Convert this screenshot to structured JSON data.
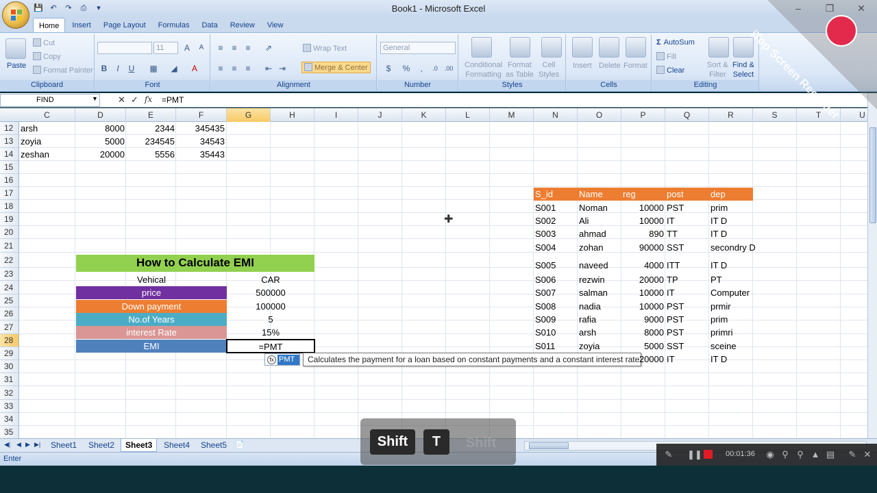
{
  "window": {
    "title": "Book1 - Microsoft Excel"
  },
  "ribbon": {
    "tabs": [
      "Home",
      "Insert",
      "Page Layout",
      "Formulas",
      "Data",
      "Review",
      "View"
    ],
    "clipboard": {
      "paste": "Paste",
      "cut": "Cut",
      "copy": "Copy",
      "format_painter": "Format Painter",
      "label": "Clipboard"
    },
    "font": {
      "size": "11",
      "label": "Font"
    },
    "alignment": {
      "wrap_text": "Wrap Text",
      "merge_center": "Merge & Center",
      "label": "Alignment"
    },
    "number": {
      "format": "General",
      "label": "Number"
    },
    "styles": {
      "conditional": "Conditional",
      "conditional2": "Formatting",
      "format_as": "Format",
      "format_as2": "as Table",
      "cell": "Cell",
      "cell2": "Styles",
      "label": "Styles"
    },
    "cells": {
      "insert": "Insert",
      "delete": "Delete",
      "format": "Format",
      "label": "Cells"
    },
    "editing": {
      "autosum": "AutoSum",
      "fill": "Fill",
      "clear": "Clear",
      "sort": "Sort &",
      "sort2": "Filter",
      "find": "Find &",
      "find2": "Select",
      "label": "Editing"
    }
  },
  "formula_bar": {
    "name_box": "FIND",
    "formula": "=PMT",
    "fx": "fx"
  },
  "columns": [
    "C",
    "D",
    "E",
    "F",
    "G",
    "H",
    "I",
    "J",
    "K",
    "L",
    "M",
    "N",
    "O",
    "P",
    "Q",
    "R",
    "S",
    "T",
    "U"
  ],
  "rows": [
    "12",
    "13",
    "14",
    "15",
    "16",
    "17",
    "18",
    "19",
    "20",
    "21",
    "22",
    "23",
    "24",
    "25",
    "26",
    "27",
    "28",
    "29",
    "30",
    "31",
    "32",
    "33",
    "34",
    "35"
  ],
  "left_table": [
    {
      "name": "arsh",
      "d": "8000",
      "e": "2344",
      "f": "345435"
    },
    {
      "name": "zoyia",
      "d": "5000",
      "e": "234545",
      "f": "34543"
    },
    {
      "name": "zeshan",
      "d": "20000",
      "e": "5556",
      "f": "35443"
    }
  ],
  "emi": {
    "title": "How to Calculate EMI",
    "vehical_label": "Vehical",
    "vehical_value": "CAR",
    "price_label": "price",
    "price_value": "500000",
    "down_label": "Down payment",
    "down_value": "100000",
    "years_label": "No.of Years",
    "years_value": "5",
    "rate_label": "interest Rate",
    "rate_value": "15%",
    "emi_label": "EMI",
    "emi_value": "=PMT",
    "colors": {
      "title": "#92d050",
      "price": "#7030a0",
      "down": "#ed7d31",
      "years": "#4bacc6",
      "rate": "#da9694",
      "emi": "#4f81bd"
    }
  },
  "autocomplete": {
    "item": "PMT",
    "tooltip": "Calculates the payment for a loan based on constant payments and a constant interest rate"
  },
  "staff_table": {
    "headers": [
      "S_id",
      "Name",
      "reg",
      "post",
      "dep"
    ],
    "rows": [
      [
        "S001",
        "Noman",
        "10000",
        "PST",
        "prim"
      ],
      [
        "S002",
        "Ali",
        "10000",
        "IT",
        "IT D"
      ],
      [
        "S003",
        "ahmad",
        "890",
        "TT",
        "IT D"
      ],
      [
        "S004",
        "zohan",
        "90000",
        "SST",
        "secondry D"
      ],
      [
        "S005",
        "naveed",
        "4000",
        "ITT",
        "IT D"
      ],
      [
        "S006",
        "rezwin",
        "20000",
        "TP",
        "PT"
      ],
      [
        "S007",
        "salman",
        "10000",
        "IT",
        "Computer"
      ],
      [
        "S008",
        "nadia",
        "10000",
        "PST",
        "prmir"
      ],
      [
        "S009",
        "rafia",
        "9000",
        "PST",
        "prim"
      ],
      [
        "S010",
        "arsh",
        "8000",
        "PST",
        "primri"
      ],
      [
        "S011",
        "zoyia",
        "5000",
        "SST",
        "sceine"
      ],
      [
        "",
        "",
        "20000",
        "IT",
        "IT D"
      ]
    ]
  },
  "sheets": [
    "Sheet1",
    "Sheet2",
    "Sheet3",
    "Sheet4",
    "Sheet5"
  ],
  "active_sheet": "Sheet3",
  "status": "Enter",
  "keystrokes": [
    "Shift",
    "T"
  ],
  "ghost_key": "Shift",
  "recorder": {
    "time": "00:01:36",
    "watermark": "iTop Screen Recorder"
  }
}
